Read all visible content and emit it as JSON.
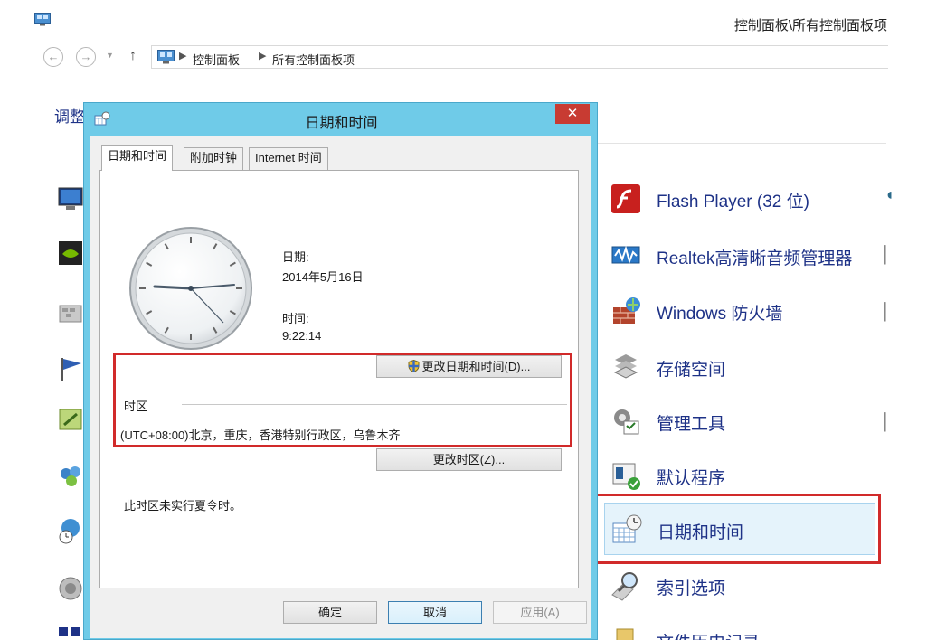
{
  "window": {
    "title": "控制面板\\所有控制面板项"
  },
  "address_bar": {
    "crumbs": [
      "控制面板",
      "所有控制面板项"
    ]
  },
  "page": {
    "heading": "调整"
  },
  "control_panel_items": [
    {
      "label": "Flash Player (32 位)",
      "icon": "flash-icon"
    },
    {
      "label": "Realtek高清晰音频管理器",
      "icon": "realtek-audio-icon"
    },
    {
      "label": "Windows 防火墙",
      "icon": "firewall-icon"
    },
    {
      "label": "存储空间",
      "icon": "storage-spaces-icon"
    },
    {
      "label": "管理工具",
      "icon": "admin-tools-icon"
    },
    {
      "label": "默认程序",
      "icon": "default-programs-icon"
    },
    {
      "label": "日期和时间",
      "icon": "date-time-icon",
      "selected": true
    },
    {
      "label": "索引选项",
      "icon": "indexing-icon"
    },
    {
      "label": "文件历史记录",
      "icon": "file-history-icon"
    }
  ],
  "dialog": {
    "title": "日期和时间",
    "close_symbol": "✕",
    "tabs": [
      "日期和时间",
      "附加时钟",
      "Internet 时间"
    ],
    "date_label": "日期:",
    "date_value": "2014年5月16日",
    "time_label": "时间:",
    "time_value": "9:22:14",
    "change_datetime_button": "更改日期和时间(D)...",
    "timezone_group_label": "时区",
    "timezone_value": "(UTC+08:00)北京，重庆，香港特别行政区，乌鲁木齐",
    "change_timezone_button": "更改时区(Z)...",
    "dst_note": "此时区未实行夏令时。",
    "ok_button": "确定",
    "cancel_button": "取消",
    "apply_button": "应用(A)"
  },
  "colors": {
    "dialog_frame": "#6fcbe8",
    "close_button": "#c83b32",
    "highlight_red": "#d12a2a",
    "link_blue": "#1e3287",
    "selected_item_bg": "#e5f3fb"
  }
}
